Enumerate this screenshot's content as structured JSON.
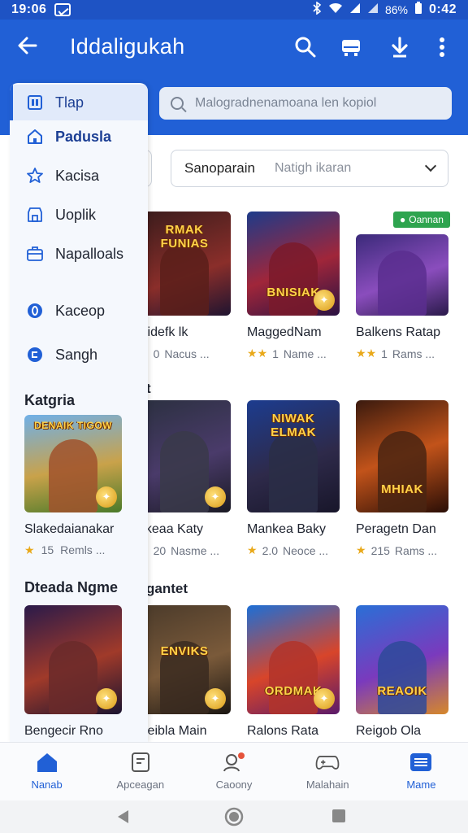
{
  "status_bar": {
    "time": "19:06",
    "battery": "86%",
    "clock_right": "0:42"
  },
  "app_bar": {
    "title": "Iddaligukah"
  },
  "search": {
    "placeholder": "Malogradnenamoana len kopiol"
  },
  "filter": {
    "selected": "Sanoparain",
    "placeholder": "Natigh ikaran"
  },
  "badge": {
    "label": "Oannan"
  },
  "drawer": {
    "items": [
      {
        "label": "Tlap",
        "icon": "apps-icon",
        "active": true
      },
      {
        "label": "Padusla",
        "icon": "home-icon"
      },
      {
        "label": "Kacisa",
        "icon": "star-outline-icon"
      },
      {
        "label": "Uoplik",
        "icon": "store-icon"
      },
      {
        "label": "Napalloals",
        "icon": "briefcase-icon"
      },
      {
        "label": "Kaceop",
        "icon": "circle-o-icon"
      },
      {
        "label": "Sangh",
        "icon": "chat-icon"
      }
    ],
    "section1_title": "Katgria",
    "card1": {
      "name": "Slakedaianakar",
      "rating": "15",
      "meta": "Remls ...",
      "caption": "DENAIK TIGOW"
    },
    "section2_title": "Dteada Ngme",
    "card2": {
      "name": "Bengecir Rno",
      "caption": ""
    }
  },
  "sections": {
    "frag1": "t",
    "frag2": "gantet"
  },
  "grid": {
    "row1": [
      {
        "name": "ixidefk lk",
        "rating": "0",
        "meta": "Nacus ...",
        "caption": "RMAK FUNIAS"
      },
      {
        "name": "MaggedNam",
        "rating": "1",
        "meta": "Name ...",
        "caption": "BNISIAK"
      },
      {
        "name": "Balkens Ratap",
        "rating": "1",
        "meta": "Rams ...",
        "caption": ""
      }
    ],
    "row2": [
      {
        "name": "okeaa Katy",
        "rating": "20",
        "meta": "Nasme ...",
        "caption": ""
      },
      {
        "name": "Mankea Baky",
        "rating": "2.0",
        "meta": "Neoce ...",
        "caption": "NIWAK ELMAK"
      },
      {
        "name": "Peragetn Dan",
        "rating": "215",
        "meta": "Rams ...",
        "caption": "MHIAK"
      }
    ],
    "row3": [
      {
        "name": "Neibla Main",
        "caption": "ENVIKS"
      },
      {
        "name": "Ralons Rata",
        "caption": "ORDMAK"
      },
      {
        "name": "Reigob Ola",
        "caption": "REAOIK"
      }
    ]
  },
  "bottom_nav": [
    {
      "label": "Nanab",
      "icon": "home-icon",
      "active": true
    },
    {
      "label": "Apceagan",
      "icon": "document-icon"
    },
    {
      "label": "Caoony",
      "icon": "community-icon"
    },
    {
      "label": "Malahain",
      "icon": "gamepad-icon"
    },
    {
      "label": "Mame",
      "icon": "menu-icon",
      "active": true
    }
  ],
  "colors": {
    "primary": "#2160d6",
    "status_bar": "#1e53c4",
    "star": "#e9a91a",
    "badge": "#2ea44f"
  }
}
